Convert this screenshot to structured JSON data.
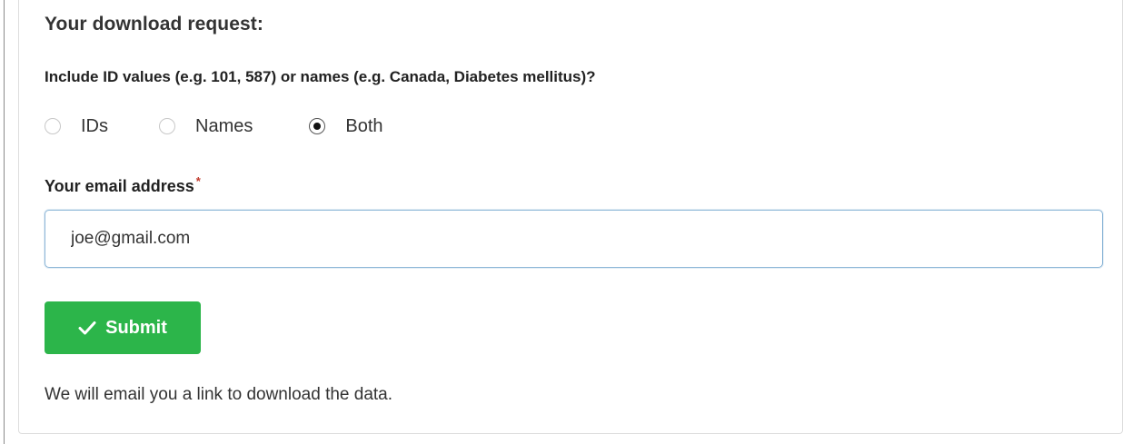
{
  "form": {
    "heading": "Your download request:",
    "question": "Include ID values (e.g. 101, 587) or names (e.g. Canada, Diabetes mellitus)?",
    "radio_options": [
      {
        "label": "IDs",
        "checked": false
      },
      {
        "label": "Names",
        "checked": false
      },
      {
        "label": "Both",
        "checked": true
      }
    ],
    "email_label": "Your email address",
    "required_marker": "*",
    "email_value": "joe@gmail.com",
    "submit_label": "Submit",
    "submit_icon": "check-icon",
    "footer_note": "We will email you a link to download the data."
  },
  "colors": {
    "submit_bg": "#2cb54a",
    "required_star": "#c0392b",
    "input_border": "#8fb8d8"
  }
}
